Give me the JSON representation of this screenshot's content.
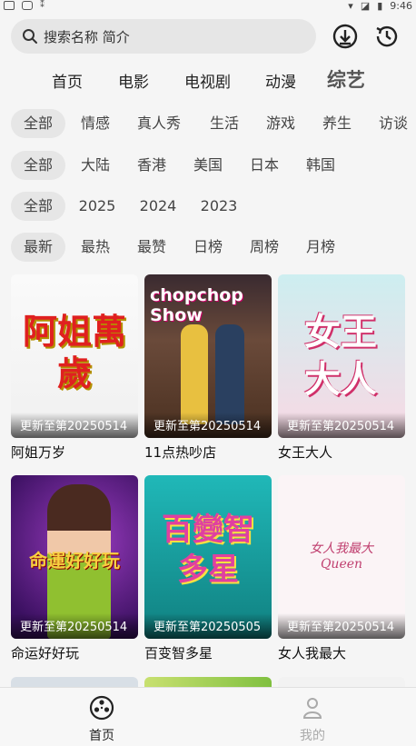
{
  "status": {
    "time": "9:46"
  },
  "search": {
    "placeholder": "搜索名称 简介"
  },
  "nav": {
    "tabs": [
      "首页",
      "电影",
      "电视剧",
      "动漫",
      "综艺"
    ],
    "active": "综艺"
  },
  "filters": {
    "genre": [
      "全部",
      "情感",
      "真人秀",
      "生活",
      "游戏",
      "养生",
      "访谈"
    ],
    "region": [
      "全部",
      "大陆",
      "香港",
      "美国",
      "日本",
      "韩国"
    ],
    "year": [
      "全部",
      "2025",
      "2024",
      "2023"
    ],
    "sort": [
      "最新",
      "最热",
      "最赞",
      "日榜",
      "周榜",
      "月榜"
    ]
  },
  "cards": [
    {
      "title": "阿姐万岁",
      "update": "更新至第20250514",
      "art": "阿姐萬歲"
    },
    {
      "title": "11点热吵店",
      "update": "更新至第20250514",
      "art": "chopchop Show"
    },
    {
      "title": "女王大人",
      "update": "更新至第20250514",
      "art": "女王大人"
    },
    {
      "title": "命运好好玩",
      "update": "更新至第20250514",
      "art": "命運好好玩"
    },
    {
      "title": "百变智多星",
      "update": "更新至第20250505",
      "art": "百變智多星"
    },
    {
      "title": "女人我最大",
      "update": "更新至第20250514",
      "art": "女人我最大 Queen"
    }
  ],
  "bottom_nav": {
    "home": "首页",
    "mine": "我的"
  },
  "colors": {
    "accent": "#222222",
    "inactive": "#aaaaaa",
    "chip_bg": "#e6e6e6"
  }
}
